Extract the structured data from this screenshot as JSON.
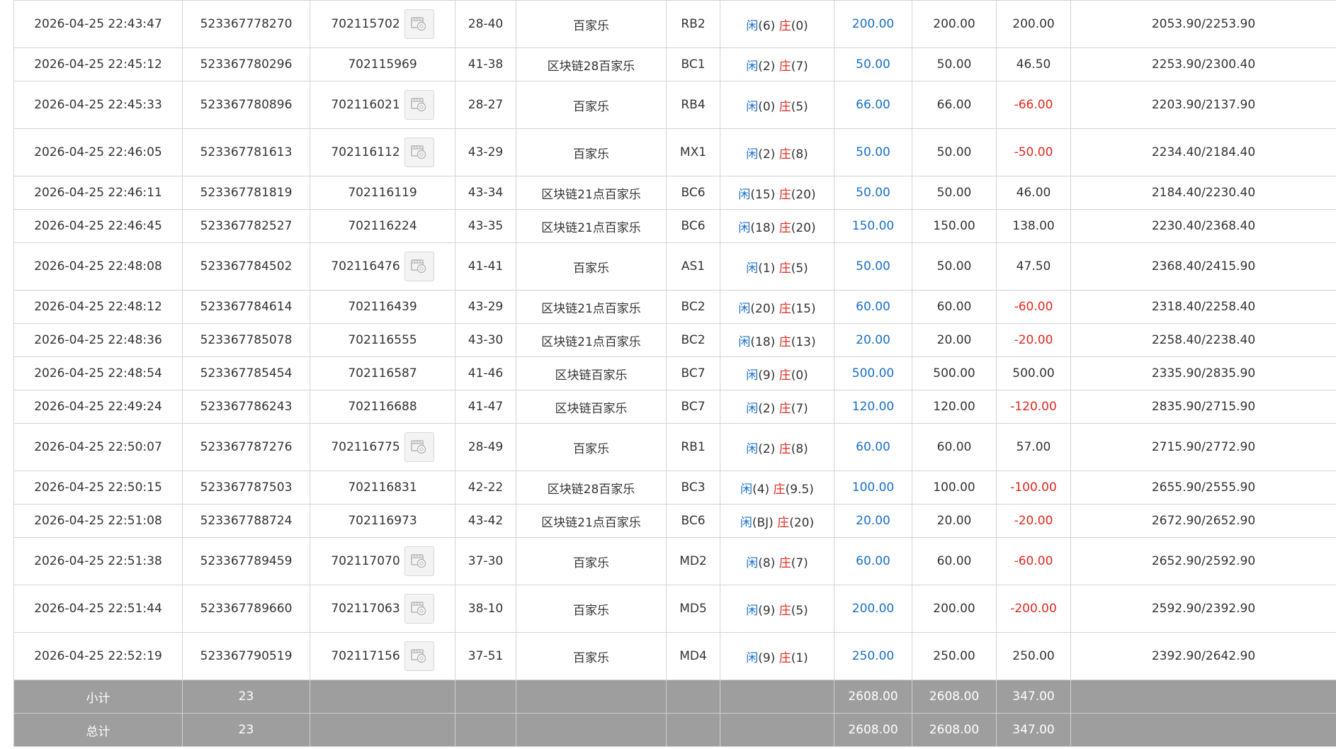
{
  "rows": [
    {
      "time": "2026-04-25 22:43:47",
      "order": "523367778270",
      "round": "702115702",
      "video": true,
      "table": "28-40",
      "game": "百家乐",
      "code": "RB2",
      "xian": "闲",
      "xian_v": "(6)",
      "zhuang": "庄",
      "zhuang_v": "(0)",
      "bet": "200.00",
      "valid": "200.00",
      "win": "200.00",
      "win_neg": false,
      "balance": "2053.90/2253.90"
    },
    {
      "time": "2026-04-25 22:45:12",
      "order": "523367780296",
      "round": "702115969",
      "video": false,
      "table": "41-38",
      "game": "区块链28百家乐",
      "code": "BC1",
      "xian": "闲",
      "xian_v": "(2)",
      "zhuang": "庄",
      "zhuang_v": "(7)",
      "bet": "50.00",
      "valid": "50.00",
      "win": "46.50",
      "win_neg": false,
      "balance": "2253.90/2300.40"
    },
    {
      "time": "2026-04-25 22:45:33",
      "order": "523367780896",
      "round": "702116021",
      "video": true,
      "table": "28-27",
      "game": "百家乐",
      "code": "RB4",
      "xian": "闲",
      "xian_v": "(0)",
      "zhuang": "庄",
      "zhuang_v": "(5)",
      "bet": "66.00",
      "valid": "66.00",
      "win": "-66.00",
      "win_neg": true,
      "balance": "2203.90/2137.90"
    },
    {
      "time": "2026-04-25 22:46:05",
      "order": "523367781613",
      "round": "702116112",
      "video": true,
      "table": "43-29",
      "game": "百家乐",
      "code": "MX1",
      "xian": "闲",
      "xian_v": "(2)",
      "zhuang": "庄",
      "zhuang_v": "(8)",
      "bet": "50.00",
      "valid": "50.00",
      "win": "-50.00",
      "win_neg": true,
      "balance": "2234.40/2184.40"
    },
    {
      "time": "2026-04-25 22:46:11",
      "order": "523367781819",
      "round": "702116119",
      "video": false,
      "table": "43-34",
      "game": "区块链21点百家乐",
      "code": "BC6",
      "xian": "闲",
      "xian_v": "(15)",
      "zhuang": "庄",
      "zhuang_v": "(20)",
      "bet": "50.00",
      "valid": "50.00",
      "win": "46.00",
      "win_neg": false,
      "balance": "2184.40/2230.40"
    },
    {
      "time": "2026-04-25 22:46:45",
      "order": "523367782527",
      "round": "702116224",
      "video": false,
      "table": "43-35",
      "game": "区块链21点百家乐",
      "code": "BC6",
      "xian": "闲",
      "xian_v": "(18)",
      "zhuang": "庄",
      "zhuang_v": "(20)",
      "bet": "150.00",
      "valid": "150.00",
      "win": "138.00",
      "win_neg": false,
      "balance": "2230.40/2368.40"
    },
    {
      "time": "2026-04-25 22:48:08",
      "order": "523367784502",
      "round": "702116476",
      "video": true,
      "table": "41-41",
      "game": "百家乐",
      "code": "AS1",
      "xian": "闲",
      "xian_v": "(1)",
      "zhuang": "庄",
      "zhuang_v": "(5)",
      "bet": "50.00",
      "valid": "50.00",
      "win": "47.50",
      "win_neg": false,
      "balance": "2368.40/2415.90"
    },
    {
      "time": "2026-04-25 22:48:12",
      "order": "523367784614",
      "round": "702116439",
      "video": false,
      "table": "43-29",
      "game": "区块链21点百家乐",
      "code": "BC2",
      "xian": "闲",
      "xian_v": "(20)",
      "zhuang": "庄",
      "zhuang_v": "(15)",
      "bet": "60.00",
      "valid": "60.00",
      "win": "-60.00",
      "win_neg": true,
      "balance": "2318.40/2258.40"
    },
    {
      "time": "2026-04-25 22:48:36",
      "order": "523367785078",
      "round": "702116555",
      "video": false,
      "table": "43-30",
      "game": "区块链21点百家乐",
      "code": "BC2",
      "xian": "闲",
      "xian_v": "(18)",
      "zhuang": "庄",
      "zhuang_v": "(13)",
      "bet": "20.00",
      "valid": "20.00",
      "win": "-20.00",
      "win_neg": true,
      "balance": "2258.40/2238.40"
    },
    {
      "time": "2026-04-25 22:48:54",
      "order": "523367785454",
      "round": "702116587",
      "video": false,
      "table": "41-46",
      "game": "区块链百家乐",
      "code": "BC7",
      "xian": "闲",
      "xian_v": "(9)",
      "zhuang": "庄",
      "zhuang_v": "(0)",
      "bet": "500.00",
      "valid": "500.00",
      "win": "500.00",
      "win_neg": false,
      "balance": "2335.90/2835.90"
    },
    {
      "time": "2026-04-25 22:49:24",
      "order": "523367786243",
      "round": "702116688",
      "video": false,
      "table": "41-47",
      "game": "区块链百家乐",
      "code": "BC7",
      "xian": "闲",
      "xian_v": "(2)",
      "zhuang": "庄",
      "zhuang_v": "(7)",
      "bet": "120.00",
      "valid": "120.00",
      "win": "-120.00",
      "win_neg": true,
      "balance": "2835.90/2715.90"
    },
    {
      "time": "2026-04-25 22:50:07",
      "order": "523367787276",
      "round": "702116775",
      "video": true,
      "table": "28-49",
      "game": "百家乐",
      "code": "RB1",
      "xian": "闲",
      "xian_v": "(2)",
      "zhuang": "庄",
      "zhuang_v": "(8)",
      "bet": "60.00",
      "valid": "60.00",
      "win": "57.00",
      "win_neg": false,
      "balance": "2715.90/2772.90"
    },
    {
      "time": "2026-04-25 22:50:15",
      "order": "523367787503",
      "round": "702116831",
      "video": false,
      "table": "42-22",
      "game": "区块链28百家乐",
      "code": "BC3",
      "xian": "闲",
      "xian_v": "(4)",
      "zhuang": "庄",
      "zhuang_v": "(9.5)",
      "bet": "100.00",
      "valid": "100.00",
      "win": "-100.00",
      "win_neg": true,
      "balance": "2655.90/2555.90"
    },
    {
      "time": "2026-04-25 22:51:08",
      "order": "523367788724",
      "round": "702116973",
      "video": false,
      "table": "43-42",
      "game": "区块链21点百家乐",
      "code": "BC6",
      "xian": "闲",
      "xian_v": "(BJ)",
      "zhuang": "庄",
      "zhuang_v": "(20)",
      "bet": "20.00",
      "valid": "20.00",
      "win": "-20.00",
      "win_neg": true,
      "balance": "2672.90/2652.90"
    },
    {
      "time": "2026-04-25 22:51:38",
      "order": "523367789459",
      "round": "702117070",
      "video": true,
      "table": "37-30",
      "game": "百家乐",
      "code": "MD2",
      "xian": "闲",
      "xian_v": "(8)",
      "zhuang": "庄",
      "zhuang_v": "(7)",
      "bet": "60.00",
      "valid": "60.00",
      "win": "-60.00",
      "win_neg": true,
      "balance": "2652.90/2592.90"
    },
    {
      "time": "2026-04-25 22:51:44",
      "order": "523367789660",
      "round": "702117063",
      "video": true,
      "table": "38-10",
      "game": "百家乐",
      "code": "MD5",
      "xian": "闲",
      "xian_v": "(9)",
      "zhuang": "庄",
      "zhuang_v": "(5)",
      "bet": "200.00",
      "valid": "200.00",
      "win": "-200.00",
      "win_neg": true,
      "balance": "2592.90/2392.90"
    },
    {
      "time": "2026-04-25 22:52:19",
      "order": "523367790519",
      "round": "702117156",
      "video": true,
      "table": "37-51",
      "game": "百家乐",
      "code": "MD4",
      "xian": "闲",
      "xian_v": "(9)",
      "zhuang": "庄",
      "zhuang_v": "(1)",
      "bet": "250.00",
      "valid": "250.00",
      "win": "250.00",
      "win_neg": false,
      "balance": "2392.90/2642.90"
    }
  ],
  "subtotal": {
    "label": "小计",
    "count": "23",
    "bet": "2608.00",
    "valid": "2608.00",
    "win": "347.00"
  },
  "total": {
    "label": "总计",
    "count": "23",
    "bet": "2608.00",
    "valid": "2608.00",
    "win": "347.00"
  },
  "colors": {
    "blue": "#1a6fc9",
    "red": "#e0281e",
    "summary_bg": "#9e9e9e"
  },
  "icons": {
    "video": "video-replay-icon"
  }
}
